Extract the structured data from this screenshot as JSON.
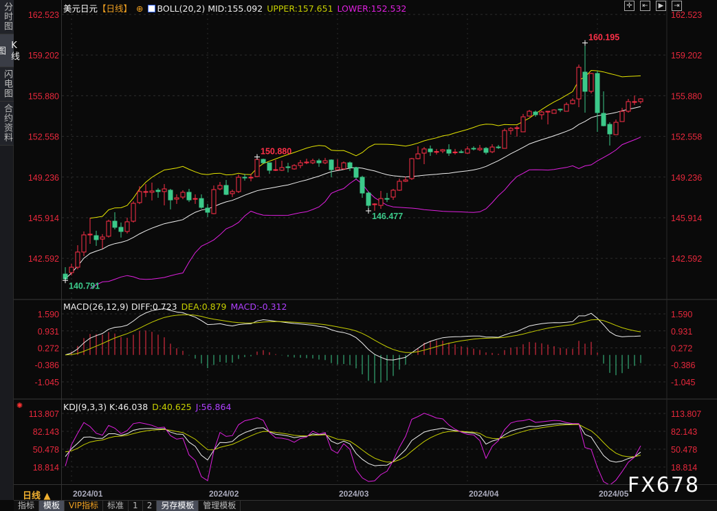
{
  "sidebar": {
    "tabs": [
      {
        "label": "分时图"
      },
      {
        "label": "K线图",
        "active": true
      },
      {
        "label": "闪电图"
      },
      {
        "label": "合约资料"
      }
    ]
  },
  "header": {
    "symbol": "美元日元",
    "period_tag": "【日线】",
    "boll_label": "BOLL(20,2) MID:155.092",
    "upper": "UPPER:157.651",
    "lower": "LOWER:152.532"
  },
  "macd_header": {
    "label": "MACD(26,12,9) DIFF:0.723",
    "dea": "DEA:0.879",
    "macd": "MACD:-0.312"
  },
  "kdj_header": {
    "label": "KDJ(9,3,3) K:46.038",
    "d": "D:40.625",
    "j": "J:56.864"
  },
  "toolbar_icons": [
    "crosshair-icon",
    "zoom-start-icon",
    "play-icon",
    "jump-end-icon"
  ],
  "period_selector": "日线 ▲",
  "bottom_tabs": [
    {
      "label": "指标"
    },
    {
      "label": "模板",
      "active": true
    },
    {
      "label": "VIP指标",
      "vip": true
    },
    {
      "label": "标准"
    },
    {
      "label": "1"
    },
    {
      "label": "2"
    },
    {
      "label": "另存模板",
      "active": true
    },
    {
      "label": "管理模板"
    }
  ],
  "watermark": "FX678",
  "colors": {
    "up": "#ff3048",
    "down": "#3cc98a",
    "mid": "#f0f0f0",
    "upper": "#e6e600",
    "lower": "#e020e0",
    "axis": "#e8283c",
    "dea": "#c8d000",
    "macd": "#b040ff"
  },
  "chart_data": {
    "type": "candlestick",
    "title": "美元日元",
    "price_axis": {
      "ticks": [
        "162.523",
        "159.202",
        "155.880",
        "152.558",
        "149.236",
        "145.914",
        "142.592"
      ],
      "ylim": [
        140.2,
        162.523
      ]
    },
    "x_ticks": [
      "2024/01",
      "2024/02",
      "2024/03",
      "2024/04",
      "2024/05"
    ],
    "x_tick_index": [
      1,
      23,
      44,
      65,
      86
    ],
    "annotations": [
      {
        "text": "160.195",
        "index": 84,
        "type": "high"
      },
      {
        "text": "150.880",
        "index": 31,
        "type": "high"
      },
      {
        "text": "146.477",
        "index": 49,
        "type": "low"
      },
      {
        "text": "140.791",
        "index": 0,
        "type": "low"
      }
    ],
    "ohlc": [
      [
        141.31,
        141.87,
        140.79,
        140.92
      ],
      [
        141.43,
        142.16,
        141.2,
        141.87
      ],
      [
        141.87,
        143.67,
        141.7,
        143.11
      ],
      [
        143.11,
        144.79,
        142.77,
        144.51
      ],
      [
        144.51,
        145.92,
        143.78,
        144.57
      ],
      [
        144.45,
        144.85,
        143.61,
        144.12
      ],
      [
        144.17,
        144.57,
        143.39,
        144.34
      ],
      [
        144.4,
        145.75,
        144.29,
        145.63
      ],
      [
        145.63,
        146.36,
        144.96,
        145.13
      ],
      [
        145.13,
        145.52,
        144.29,
        144.79
      ],
      [
        144.79,
        145.92,
        144.62,
        145.58
      ],
      [
        145.63,
        147.26,
        145.52,
        147.09
      ],
      [
        147.15,
        148.49,
        147.03,
        148.05
      ],
      [
        147.99,
        148.66,
        147.6,
        148.05
      ],
      [
        147.99,
        148.78,
        147.32,
        148.1
      ],
      [
        148.16,
        148.33,
        147.54,
        148.05
      ],
      [
        148.05,
        148.66,
        146.92,
        148.27
      ],
      [
        148.16,
        148.27,
        146.59,
        147.37
      ],
      [
        147.43,
        147.82,
        147.04,
        147.54
      ],
      [
        147.6,
        148.16,
        147.43,
        147.99
      ],
      [
        147.99,
        148.27,
        147.2,
        147.37
      ],
      [
        147.43,
        147.82,
        147.04,
        147.48
      ],
      [
        147.48,
        147.82,
        146.64,
        146.76
      ],
      [
        146.7,
        147.04,
        145.97,
        146.36
      ],
      [
        146.25,
        148.55,
        146.2,
        148.21
      ],
      [
        148.27,
        148.83,
        148.16,
        148.55
      ],
      [
        148.55,
        149.0,
        147.76,
        147.82
      ],
      [
        147.88,
        148.21,
        147.6,
        148.05
      ],
      [
        148.05,
        149.45,
        147.93,
        149.22
      ],
      [
        149.22,
        149.5,
        148.94,
        149.2
      ],
      [
        149.17,
        149.5,
        148.89,
        149.22
      ],
      [
        149.28,
        150.88,
        149.22,
        150.68
      ],
      [
        150.68,
        150.74,
        150.35,
        150.4
      ],
      [
        150.4,
        150.4,
        149.5,
        149.79
      ],
      [
        149.79,
        150.63,
        149.73,
        149.84
      ],
      [
        149.79,
        150.57,
        149.73,
        150.01
      ],
      [
        150.07,
        150.4,
        149.62,
        150.01
      ],
      [
        149.9,
        150.29,
        149.84,
        150.18
      ],
      [
        150.18,
        150.63,
        149.95,
        150.4
      ],
      [
        150.4,
        150.74,
        150.29,
        150.46
      ],
      [
        150.4,
        150.74,
        150.29,
        150.57
      ],
      [
        150.57,
        150.74,
        150.07,
        150.4
      ],
      [
        150.4,
        150.8,
        150.29,
        150.57
      ],
      [
        150.63,
        150.68,
        149.22,
        149.84
      ],
      [
        149.84,
        150.68,
        149.79,
        150.01
      ],
      [
        149.9,
        150.51,
        149.84,
        150.4
      ],
      [
        150.4,
        150.51,
        149.73,
        150.01
      ],
      [
        150.01,
        150.07,
        149.06,
        149.22
      ],
      [
        149.22,
        149.34,
        147.54,
        147.93
      ],
      [
        147.93,
        148.05,
        146.477,
        146.92
      ],
      [
        146.98,
        147.09,
        146.48,
        147.04
      ],
      [
        146.92,
        148.1,
        146.64,
        147.48
      ],
      [
        147.48,
        147.94,
        147.2,
        147.43
      ],
      [
        147.6,
        148.27,
        147.37,
        148.16
      ],
      [
        148.16,
        149.11,
        148.1,
        148.89
      ],
      [
        148.89,
        149.28,
        148.83,
        149.0
      ],
      [
        149.11,
        150.8,
        149.0,
        150.74
      ],
      [
        150.74,
        151.75,
        150.68,
        151.13
      ],
      [
        151.19,
        151.69,
        150.29,
        151.53
      ],
      [
        151.53,
        151.81,
        150.96,
        151.3
      ],
      [
        151.3,
        151.53,
        151.08,
        151.32
      ],
      [
        151.36,
        151.53,
        151.19,
        151.47
      ],
      [
        151.47,
        151.92,
        150.96,
        151.19
      ],
      [
        151.25,
        151.53,
        151.08,
        151.28
      ],
      [
        151.3,
        151.47,
        151.19,
        151.28
      ],
      [
        151.19,
        151.75,
        151.13,
        151.53
      ],
      [
        151.58,
        151.75,
        151.41,
        151.55
      ],
      [
        151.47,
        151.86,
        151.36,
        151.58
      ],
      [
        151.58,
        151.69,
        151.08,
        151.25
      ],
      [
        151.3,
        151.92,
        151.19,
        151.69
      ],
      [
        151.69,
        151.86,
        151.53,
        151.67
      ],
      [
        151.58,
        153.21,
        151.58,
        153.04
      ],
      [
        153.04,
        153.32,
        152.7,
        153.21
      ],
      [
        153.21,
        153.43,
        152.54,
        153.26
      ],
      [
        152.93,
        154.39,
        152.93,
        154.16
      ],
      [
        154.22,
        154.72,
        154.16,
        154.61
      ],
      [
        154.55,
        154.67,
        154.16,
        154.33
      ],
      [
        154.33,
        154.67,
        153.94,
        154.55
      ],
      [
        154.55,
        154.61,
        153.54,
        154.61
      ],
      [
        154.44,
        154.78,
        154.44,
        154.72
      ],
      [
        154.78,
        154.83,
        154.55,
        154.76
      ],
      [
        154.61,
        155.34,
        154.61,
        155.17
      ],
      [
        155.23,
        155.68,
        155.17,
        155.51
      ],
      [
        155.62,
        158.43,
        154.95,
        158.2
      ],
      [
        157.81,
        160.195,
        154.5,
        156.24
      ],
      [
        156.24,
        157.75,
        156.07,
        157.7
      ],
      [
        157.7,
        157.92,
        152.93,
        154.5
      ],
      [
        154.44,
        156.24,
        153.38,
        153.43
      ],
      [
        153.54,
        153.71,
        151.81,
        152.76
      ],
      [
        152.7,
        153.94,
        152.7,
        153.71
      ],
      [
        153.77,
        154.89,
        153.77,
        154.61
      ],
      [
        154.61,
        155.62,
        154.5,
        155.4
      ],
      [
        155.34,
        155.9,
        155.12,
        155.4
      ],
      [
        155.4,
        155.68,
        155.23,
        155.62
      ]
    ],
    "indicators": {
      "boll": {
        "period": 20,
        "k": 2
      },
      "macd": {
        "fast": 12,
        "slow": 26,
        "signal": 9
      },
      "kdj": {
        "n": 9,
        "m1": 3,
        "m2": 3
      }
    },
    "macd_axis": {
      "ticks": [
        "1.590",
        "0.931",
        "0.272",
        "-0.386",
        "-1.045"
      ],
      "ylim": [
        -1.3,
        1.85
      ]
    },
    "kdj_axis": {
      "ticks": [
        "113.807",
        "82.143",
        "50.478",
        "18.814"
      ],
      "ylim": [
        5,
        125
      ]
    }
  }
}
